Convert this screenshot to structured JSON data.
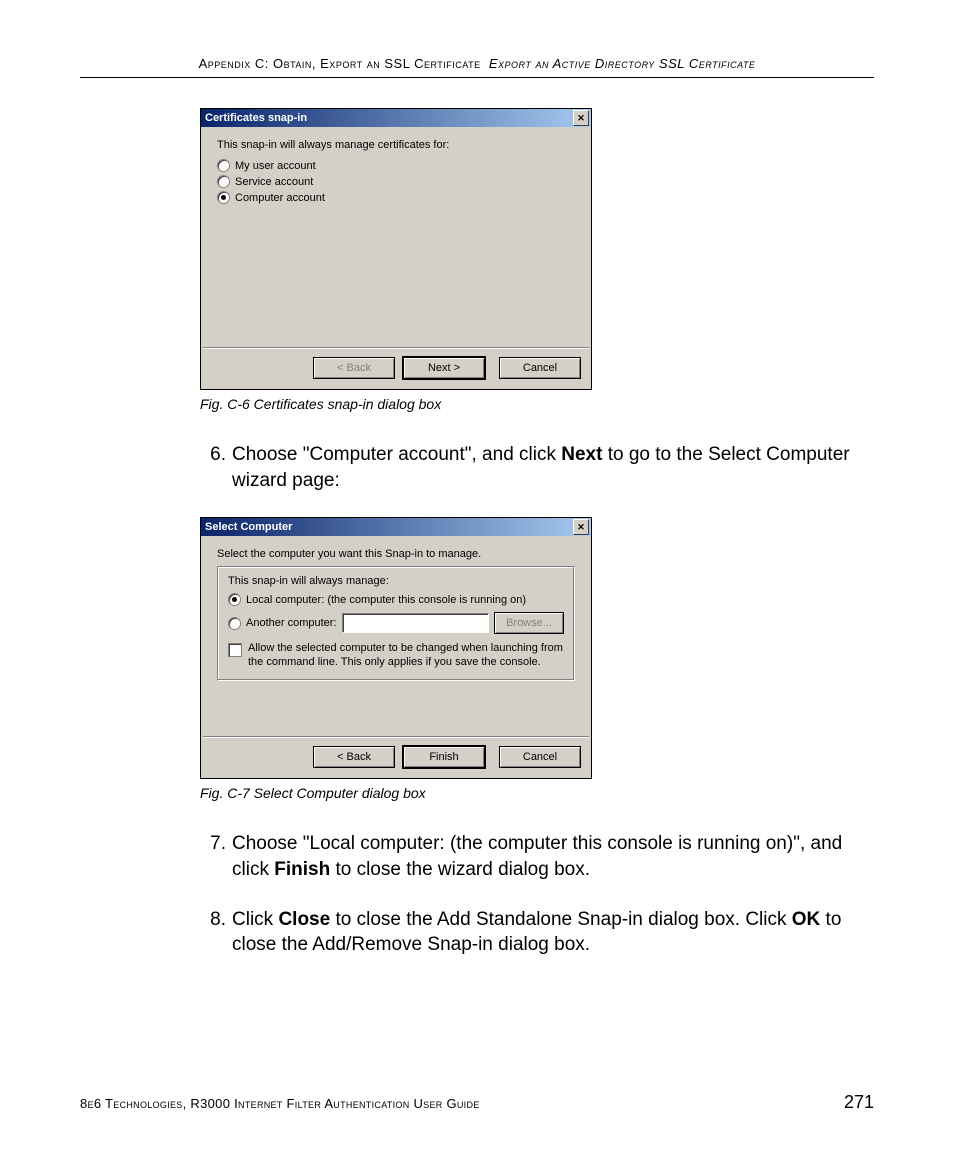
{
  "header": {
    "line1_left": "Appendix C: Obtain, Export an SSL Certificate",
    "line1_right": "Export an Active Directory SSL Certificate"
  },
  "dialog1": {
    "title": "Certificates snap-in",
    "prompt": "This snap-in will always manage certificates for:",
    "options": [
      "My user account",
      "Service account",
      "Computer account"
    ],
    "selected_index": 2,
    "buttons": {
      "back": "< Back",
      "next": "Next >",
      "cancel": "Cancel"
    }
  },
  "caption1": "Fig. C-6  Certificates snap-in dialog box",
  "step6": {
    "num": "6.",
    "pre": "Choose \"Computer account\", and click ",
    "bold": "Next",
    "post": " to go to the Select Computer wizard page:"
  },
  "dialog2": {
    "title": "Select Computer",
    "line1": "Select the computer you want this Snap-in to manage.",
    "group_label": "This snap-in will always manage:",
    "opt_local": "Local computer:  (the computer this console is running on)",
    "opt_another": "Another computer:",
    "browse": "Browse...",
    "check_text": "Allow the selected computer to be changed when launching from the command line.  This only applies if you save the console.",
    "buttons": {
      "back": "< Back",
      "finish": "Finish",
      "cancel": "Cancel"
    }
  },
  "caption2": "Fig. C-7  Select Computer dialog box",
  "step7": {
    "num": "7.",
    "pre": "Choose \"Local computer: (the computer this console is running on)\", and click ",
    "bold": "Finish",
    "post": " to close the wizard dialog box."
  },
  "step8": {
    "num": "8.",
    "p1": "Click ",
    "b1": "Close",
    "p2": " to close the Add Standalone Snap-in dialog box. Click ",
    "b2": "OK",
    "p3": " to close the Add/Remove Snap-in dialog box."
  },
  "footer": {
    "left": "8e6 Technologies, R3000 Internet Filter Authentication User Guide",
    "right": "271"
  }
}
